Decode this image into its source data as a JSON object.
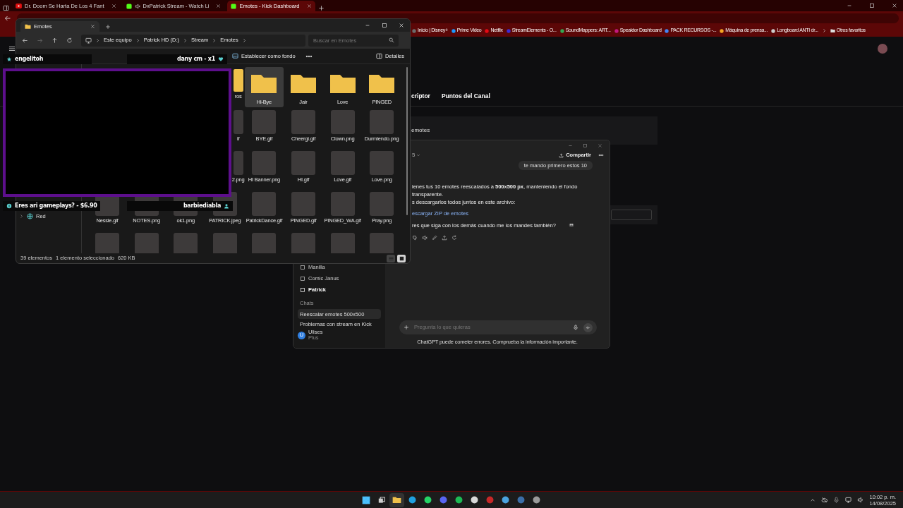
{
  "browser": {
    "tabs": [
      {
        "title": "Dr. Doom Se Harta De Los 4 Fant",
        "kind": "youtube",
        "muted": false,
        "selected": false
      },
      {
        "title": "DxPatrick Stream - Watch Li",
        "kind": "kick",
        "muted": true,
        "selected": false
      },
      {
        "title": "Emotes - Kick Dashboard",
        "kind": "kick",
        "muted": false,
        "selected": true
      }
    ],
    "bookmarks": [
      {
        "label": "Inicio | Disney+",
        "color": "#6b6b6b"
      },
      {
        "label": "Prime Video",
        "color": "#1a98ff"
      },
      {
        "label": "Netflix",
        "color": "#e50914"
      },
      {
        "label": "StreamElements - O...",
        "color": "#3d2bd6"
      },
      {
        "label": "SoundMappers: ART...",
        "color": "#34a853"
      },
      {
        "label": "Speaktor Dashboard",
        "color": "#c2187f"
      },
      {
        "label": "PACK RECURSOS -...",
        "color": "#4285f4"
      },
      {
        "label": "Máquina de prensa...",
        "color": "#f5a623"
      },
      {
        "label": "Longboard ANTI dr...",
        "color": "#cccccc"
      }
    ],
    "other_favorites": "Otros favoritos"
  },
  "kick": {
    "tabs": [
      "criptor",
      "Puntos del Canal"
    ],
    "section": "emotes"
  },
  "explorer": {
    "tab": "Emotes",
    "breadcrumb": [
      "Este equipo",
      "Patrick HD (D:)",
      "Stream",
      "Emotes"
    ],
    "search_placeholder": "Buscar en Emotes",
    "set_background": "Establecer como fondo",
    "details": "Detalles",
    "nav": [
      {
        "label": "Red",
        "expanded": false
      }
    ],
    "items": [
      {
        "label": "ros",
        "kind": "folder",
        "partial": true,
        "selected": false
      },
      {
        "label": "Hi-Bye",
        "kind": "folder",
        "selected": true
      },
      {
        "label": "Jair",
        "kind": "folder",
        "selected": false
      },
      {
        "label": "Love",
        "kind": "folder",
        "selected": false
      },
      {
        "label": "PINGED",
        "kind": "folder",
        "selected": false
      },
      {
        "label": "if",
        "kind": "image",
        "partial": true,
        "selected": false
      },
      {
        "label": "BYE.gif",
        "kind": "image",
        "selected": false
      },
      {
        "label": "Cheergi.gif",
        "kind": "image",
        "selected": false
      },
      {
        "label": "Clown.png",
        "kind": "image",
        "selected": false
      },
      {
        "label": "Durmiendo.png",
        "kind": "image",
        "selected": false
      },
      {
        "label": "2.png",
        "kind": "image",
        "partial": true,
        "selected": false
      },
      {
        "label": "HI Banner.png",
        "kind": "image",
        "selected": false
      },
      {
        "label": "HI.gif",
        "kind": "image",
        "selected": false
      },
      {
        "label": "Love.gif",
        "kind": "image",
        "selected": false
      },
      {
        "label": "Love.png",
        "kind": "image",
        "selected": false
      },
      {
        "label": "Nessie.gif",
        "kind": "image",
        "selected": false
      },
      {
        "label": "NOTES.png",
        "kind": "image",
        "selected": false
      },
      {
        "label": "ok1.png",
        "kind": "image",
        "selected": false
      },
      {
        "label": "PATRICK.jpeg",
        "kind": "image",
        "selected": false
      },
      {
        "label": "PatrickDance.gif",
        "kind": "image",
        "selected": false
      },
      {
        "label": "PINGED.gif",
        "kind": "image",
        "selected": false
      },
      {
        "label": "PINGED_WA.gif",
        "kind": "image",
        "selected": false
      },
      {
        "label": "Pray.png",
        "kind": "image",
        "selected": false
      },
      {
        "kind": "image",
        "selected": false
      },
      {
        "kind": "image",
        "selected": false
      },
      {
        "kind": "image",
        "selected": false
      },
      {
        "kind": "image",
        "selected": false
      },
      {
        "kind": "image",
        "selected": false
      },
      {
        "kind": "image",
        "selected": false
      },
      {
        "kind": "image",
        "selected": false
      },
      {
        "kind": "image",
        "selected": false
      }
    ],
    "status": {
      "count": "39 elementos",
      "selection": "1 elemento seleccionado",
      "size": "620 KB"
    },
    "view_modes": [
      {
        "kind": "details",
        "selected": false
      },
      {
        "kind": "tiles",
        "selected": true
      }
    ]
  },
  "overlay": {
    "top_left": "engelitoh",
    "top_right": "dany cm - x1",
    "bottom_left": "Eres ari gameplays? - $6.90",
    "bottom_right": "barbiediabla"
  },
  "chatgpt": {
    "sidebar": {
      "projects": [
        {
          "label": "Manilla",
          "selected": false
        },
        {
          "label": "Comic Janus",
          "selected": false
        },
        {
          "label": "Patrick",
          "selected": true
        }
      ],
      "chats_heading": "Chats",
      "chats": [
        {
          "title": "Reescalar emotes 500x500",
          "selected": true
        },
        {
          "title": "Problemas con stream en Kick",
          "selected": false
        }
      ],
      "user": {
        "initial": "U",
        "name": "Ulises",
        "plan": "Plus"
      }
    },
    "model": "5",
    "share": "Compartir",
    "user_message": "te mando primero estos 10",
    "reply": [
      "ienes tus 10 emotes reescalados a **500x500 px**, manteniendo el fondo transparente.",
      "s descargarlos todos juntos en este archivo:"
    ],
    "link": "escargar ZIP de emotes",
    "question": "res que siga con los demás cuando me los mandes también?",
    "input_placeholder": "Pregunta lo que quieras",
    "disclaimer": "ChatGPT puede cometer errores. Comprueba la información importante."
  },
  "taskbar": {
    "apps": [
      {
        "kind": "start",
        "color": "#4cc2ff",
        "selected": false
      },
      {
        "kind": "taskview",
        "color": "#cfcfcf",
        "selected": false
      },
      {
        "kind": "folder",
        "color": "#f0c14b",
        "selected": true
      },
      {
        "kind": "app",
        "color": "#1fa0e0",
        "selected": false
      },
      {
        "kind": "app",
        "color": "#25d366",
        "selected": false
      },
      {
        "kind": "app",
        "color": "#5865f2",
        "selected": false
      },
      {
        "kind": "app",
        "color": "#1db954",
        "selected": false
      },
      {
        "kind": "app",
        "color": "#d8d8d8",
        "selected": false
      },
      {
        "kind": "app",
        "color": "#c62828",
        "selected": false
      },
      {
        "kind": "app",
        "color": "#4aa3df",
        "selected": false
      },
      {
        "kind": "app",
        "color": "#3b6ea8",
        "selected": false
      },
      {
        "kind": "app",
        "color": "#9a9a9a",
        "selected": false
      }
    ],
    "time": "10:02 p. m.",
    "date": "14/08/2025"
  }
}
